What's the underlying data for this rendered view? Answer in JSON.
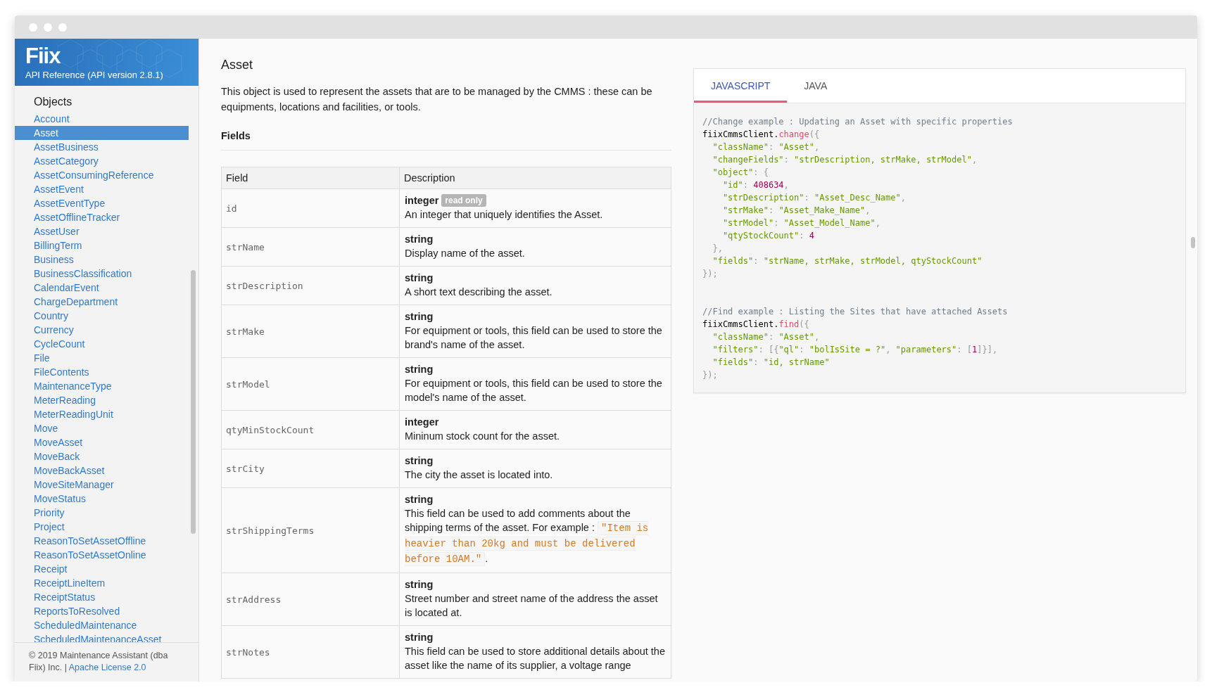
{
  "header": {
    "logo": "Fiix",
    "subtitle": "API Reference (API version 2.8.1)"
  },
  "sidebar": {
    "heading": "Objects",
    "items": [
      {
        "label": "Account",
        "selected": false
      },
      {
        "label": "Asset",
        "selected": true
      },
      {
        "label": "AssetBusiness",
        "selected": false
      },
      {
        "label": "AssetCategory",
        "selected": false
      },
      {
        "label": "AssetConsumingReference",
        "selected": false
      },
      {
        "label": "AssetEvent",
        "selected": false
      },
      {
        "label": "AssetEventType",
        "selected": false
      },
      {
        "label": "AssetOfflineTracker",
        "selected": false
      },
      {
        "label": "AssetUser",
        "selected": false
      },
      {
        "label": "BillingTerm",
        "selected": false
      },
      {
        "label": "Business",
        "selected": false
      },
      {
        "label": "BusinessClassification",
        "selected": false
      },
      {
        "label": "CalendarEvent",
        "selected": false
      },
      {
        "label": "ChargeDepartment",
        "selected": false
      },
      {
        "label": "Country",
        "selected": false
      },
      {
        "label": "Currency",
        "selected": false
      },
      {
        "label": "CycleCount",
        "selected": false
      },
      {
        "label": "File",
        "selected": false
      },
      {
        "label": "FileContents",
        "selected": false
      },
      {
        "label": "MaintenanceType",
        "selected": false
      },
      {
        "label": "MeterReading",
        "selected": false
      },
      {
        "label": "MeterReadingUnit",
        "selected": false
      },
      {
        "label": "Move",
        "selected": false
      },
      {
        "label": "MoveAsset",
        "selected": false
      },
      {
        "label": "MoveBack",
        "selected": false
      },
      {
        "label": "MoveBackAsset",
        "selected": false
      },
      {
        "label": "MoveSiteManager",
        "selected": false
      },
      {
        "label": "MoveStatus",
        "selected": false
      },
      {
        "label": "Priority",
        "selected": false
      },
      {
        "label": "Project",
        "selected": false
      },
      {
        "label": "ReasonToSetAssetOffline",
        "selected": false
      },
      {
        "label": "ReasonToSetAssetOnline",
        "selected": false
      },
      {
        "label": "Receipt",
        "selected": false
      },
      {
        "label": "ReceiptLineItem",
        "selected": false
      },
      {
        "label": "ReceiptStatus",
        "selected": false
      },
      {
        "label": "ReportsToResolved",
        "selected": false
      },
      {
        "label": "ScheduledMaintenance",
        "selected": false
      },
      {
        "label": "ScheduledMaintenanceAsset",
        "selected": false
      }
    ],
    "footer": {
      "text": "© 2019 Maintenance Assistant (dba Fiix) Inc.",
      "separator": "|",
      "link": "Apache License 2.0"
    }
  },
  "content": {
    "title": "Asset",
    "description": "This object is used to represent the assets that are to be managed by the CMMS : these can be equipments, locations and facilities, or tools.",
    "section": "Fields",
    "table": {
      "columns": [
        "Field",
        "Description"
      ],
      "rows": [
        {
          "field": "id",
          "type": "integer",
          "badge": "read only",
          "description": "An integer that uniquely identifies the Asset."
        },
        {
          "field": "strName",
          "type": "string",
          "description": "Display name of the asset."
        },
        {
          "field": "strDescription",
          "type": "string",
          "description": "A short text describing the asset."
        },
        {
          "field": "strMake",
          "type": "string",
          "description": "For equipment or tools, this field can be used to store the brand's name of the asset."
        },
        {
          "field": "strModel",
          "type": "string",
          "description": "For equipment or tools, this field can be used to store the model's name of the asset."
        },
        {
          "field": "qtyMinStockCount",
          "type": "integer",
          "description": "Mininum stock count for the asset."
        },
        {
          "field": "strCity",
          "type": "string",
          "description": "The city the asset is located into."
        },
        {
          "field": "strShippingTerms",
          "type": "string",
          "description": "This field can be used to add comments about the shipping terms of the asset. For example :",
          "example": "\"Item is heavier than 20kg and must be delivered before 10AM.\"",
          "after": "."
        },
        {
          "field": "strAddress",
          "type": "string",
          "description": "Street number and street name of the address the asset is located at."
        },
        {
          "field": "strNotes",
          "type": "string",
          "description": "This field can be used to store additional details about the asset like the name of its supplier, a voltage range"
        }
      ]
    }
  },
  "code_panel": {
    "tabs": [
      {
        "label": "JAVASCRIPT",
        "selected": true
      },
      {
        "label": "JAVA",
        "selected": false
      }
    ],
    "blocks": [
      {
        "lines": [
          [
            {
              "kind": "comment",
              "text": "//Change example : Updating an Asset with specific properties"
            }
          ],
          [
            {
              "kind": "plain",
              "text": "fiixCmmsClient."
            },
            {
              "kind": "method",
              "text": "change"
            },
            {
              "kind": "punct",
              "text": "({"
            }
          ],
          [
            {
              "kind": "string",
              "text": "  \"className\""
            },
            {
              "kind": "punct",
              "text": ": "
            },
            {
              "kind": "string",
              "text": "\"Asset\""
            },
            {
              "kind": "punct",
              "text": ","
            }
          ],
          [
            {
              "kind": "string",
              "text": "  \"changeFields\""
            },
            {
              "kind": "punct",
              "text": ": "
            },
            {
              "kind": "string",
              "text": "\"strDescription, strMake, strModel\""
            },
            {
              "kind": "punct",
              "text": ","
            }
          ],
          [
            {
              "kind": "string",
              "text": "  \"object\""
            },
            {
              "kind": "punct",
              "text": ": {"
            }
          ],
          [
            {
              "kind": "string",
              "text": "    \"id\""
            },
            {
              "kind": "punct",
              "text": ": "
            },
            {
              "kind": "number",
              "text": "408634"
            },
            {
              "kind": "punct",
              "text": ","
            }
          ],
          [
            {
              "kind": "string",
              "text": "    \"strDescription\""
            },
            {
              "kind": "punct",
              "text": ": "
            },
            {
              "kind": "string",
              "text": "\"Asset_Desc_Name\""
            },
            {
              "kind": "punct",
              "text": ","
            }
          ],
          [
            {
              "kind": "string",
              "text": "    \"strMake\""
            },
            {
              "kind": "punct",
              "text": ": "
            },
            {
              "kind": "string",
              "text": "\"Asset_Make_Name\""
            },
            {
              "kind": "punct",
              "text": ","
            }
          ],
          [
            {
              "kind": "string",
              "text": "    \"strModel\""
            },
            {
              "kind": "punct",
              "text": ": "
            },
            {
              "kind": "string",
              "text": "\"Asset_Model_Name\""
            },
            {
              "kind": "punct",
              "text": ","
            }
          ],
          [
            {
              "kind": "string",
              "text": "    \"qtyStockCount\""
            },
            {
              "kind": "punct",
              "text": ": "
            },
            {
              "kind": "number",
              "text": "4"
            }
          ],
          [
            {
              "kind": "punct",
              "text": "  },"
            }
          ],
          [
            {
              "kind": "string",
              "text": "  \"fields\""
            },
            {
              "kind": "punct",
              "text": ": "
            },
            {
              "kind": "string",
              "text": "\"strName, strMake, strModel, qtyStockCount\""
            }
          ],
          [
            {
              "kind": "punct",
              "text": "});"
            }
          ]
        ]
      },
      {
        "lines": [
          [
            {
              "kind": "comment",
              "text": "//Find example : Listing the Sites that have attached Assets"
            }
          ],
          [
            {
              "kind": "plain",
              "text": "fiixCmmsClient."
            },
            {
              "kind": "method",
              "text": "find"
            },
            {
              "kind": "punct",
              "text": "({"
            }
          ],
          [
            {
              "kind": "string",
              "text": "  \"className\""
            },
            {
              "kind": "punct",
              "text": ": "
            },
            {
              "kind": "string",
              "text": "\"Asset\""
            },
            {
              "kind": "punct",
              "text": ","
            }
          ],
          [
            {
              "kind": "string",
              "text": "  \"filters\""
            },
            {
              "kind": "punct",
              "text": ": [{"
            },
            {
              "kind": "string",
              "text": "\"ql\""
            },
            {
              "kind": "punct",
              "text": ": "
            },
            {
              "kind": "string",
              "text": "\"bolIsSite = ?\""
            },
            {
              "kind": "punct",
              "text": ", "
            },
            {
              "kind": "string",
              "text": "\"parameters\""
            },
            {
              "kind": "punct",
              "text": ": ["
            },
            {
              "kind": "number",
              "text": "1"
            },
            {
              "kind": "punct",
              "text": "]}],"
            }
          ],
          [
            {
              "kind": "string",
              "text": "  \"fields\""
            },
            {
              "kind": "punct",
              "text": ": "
            },
            {
              "kind": "string",
              "text": "\"id, strName\""
            }
          ],
          [
            {
              "kind": "punct",
              "text": "});"
            }
          ]
        ]
      }
    ]
  }
}
